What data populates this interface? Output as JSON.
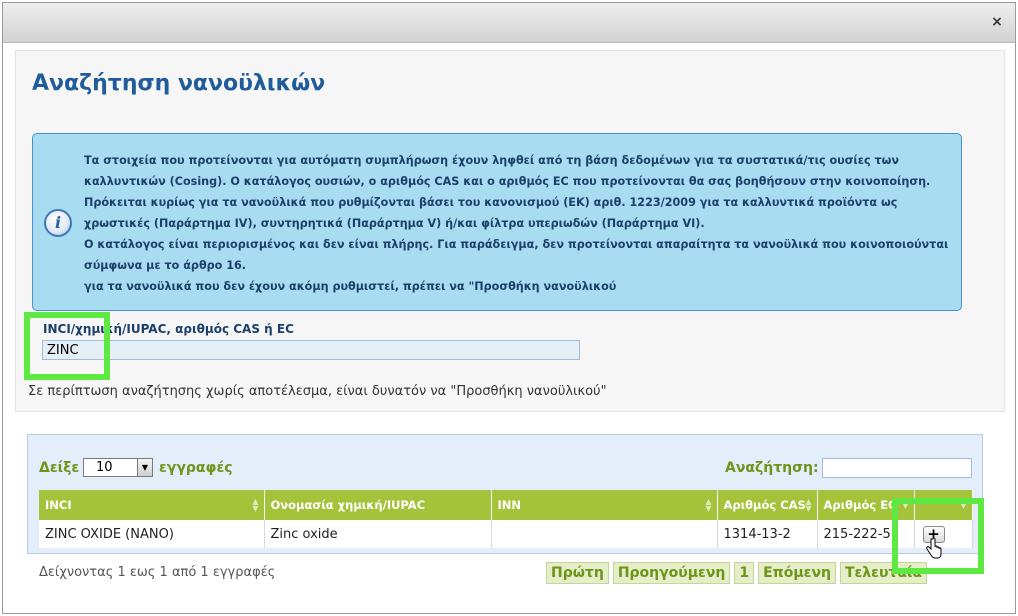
{
  "window": {
    "close_symbol": "×"
  },
  "page": {
    "title": "Αναζήτηση νανοϋλικών"
  },
  "info": {
    "icon": "info-icon",
    "lines": [
      "Τα στοιχεία που προτείνονται για αυτόματη συμπλήρωση έχουν ληφθεί από τη βάση δεδομένων για τα συστατικά/τις ουσίες των",
      "καλλυντικών (Cosing). Ο κατάλογος ουσιών, ο αριθμός CAS και ο αριθμός EC που προτείνονται θα σας βοηθήσουν στην κοινοποίηση.",
      "Πρόκειται κυρίως για τα νανοϋλικά που ρυθμίζονται βάσει του κανονισμού (ΕΚ) αριθ. 1223/2009 για τα καλλυντικά προϊόντα ως",
      "χρωστικές (Παράρτημα IV), συντηρητικά (Παράρτημα V) ή/και φίλτρα υπεριωδών (Παράρτημα VI).",
      "Ο κατάλογος είναι περιορισμένος και δεν είναι πλήρης. Για παράδειγμα, δεν προτείνονται απαραίτητα τα νανοϋλικά που κοινοποιούνται",
      "σύμφωνα με το άρθρο 16.",
      "για τα νανοϋλικά που δεν έχουν ακόμη ρυθμιστεί, πρέπει να \"Προσθήκη νανοϋλικού"
    ]
  },
  "search": {
    "label": "INCI/χημική/IUPAC, αριθμός CAS ή EC",
    "value": "ZINC"
  },
  "hint": "Σε περίπτωση αναζήτησης χωρίς αποτέλεσμα, είναι δυνατόν να \"Προσθήκη νανοϋλικού\"",
  "table": {
    "show_label": "Δείξε",
    "page_size": "10",
    "records_label": "εγγραφές",
    "filter_label": "Αναζήτηση:",
    "filter_value": "",
    "columns": [
      "INCI",
      "Ονομασία χημική/IUPAC",
      "INN",
      "Αριθμός CAS",
      "Αριθμός EC",
      ""
    ],
    "rows": [
      {
        "inci": "ZINC OXIDE (NANO)",
        "chemical": "Zinc oxide",
        "inn": "",
        "cas": "1314-13-2",
        "ec": "215-222-5",
        "action": "+"
      }
    ],
    "footer": "Δείχνοντας 1 εως 1 από 1 εγγραφές",
    "pager": {
      "first": "Πρώτη",
      "previous": "Προηγούμενη",
      "current": "1",
      "next": "Επόμενη",
      "last": "Τελευταία"
    }
  },
  "colors": {
    "accent_green": "#a4c23a",
    "title_blue": "#1f5c99",
    "info_bg": "#a8dcf0",
    "highlight": "#5ee842"
  }
}
